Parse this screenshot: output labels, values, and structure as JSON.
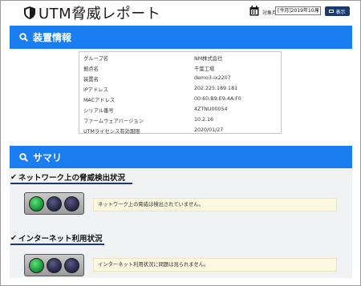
{
  "header": {
    "title": "UTM脅威レポート",
    "period_label": "対象月",
    "period_value": "[今月]2019年10月",
    "show_label": "表示"
  },
  "device_section": {
    "title": "装置情報",
    "rows": [
      {
        "label": "グループ名",
        "value": "NM株式会社"
      },
      {
        "label": "拠点名",
        "value": "千葉工場"
      },
      {
        "label": "装置名",
        "value": "demo3-ix2207"
      },
      {
        "label": "IPアドレス",
        "value": "202.225.189.181"
      },
      {
        "label": "MACアドレス",
        "value": "00:60:B9:E9:4A:F0"
      },
      {
        "label": "シリアル番号",
        "value": "4ZTNU00054"
      },
      {
        "label": "ファームウェアバージョン",
        "value": "10.2.16"
      },
      {
        "label": "UTMライセンス有効期限",
        "value": "2020/01/27"
      }
    ]
  },
  "summary_section": {
    "title": "サマリ",
    "threat": {
      "heading": "ネットワーク上の脅威検出状況",
      "status": "ネットワーク上の脅威は検出されていません。",
      "lamp": "green"
    },
    "internet": {
      "heading": "インターネット利用状況",
      "status": "インターネット利用状況に問題は見られません。",
      "lamp": "green"
    }
  },
  "colors": {
    "banner": "#1a7df0",
    "navy": "#1b3a6b",
    "status_bg": "#fbf8e0"
  },
  "icons": [
    "shield-icon",
    "calendar-icon",
    "monitor-icon",
    "search-icon",
    "check-icon"
  ]
}
